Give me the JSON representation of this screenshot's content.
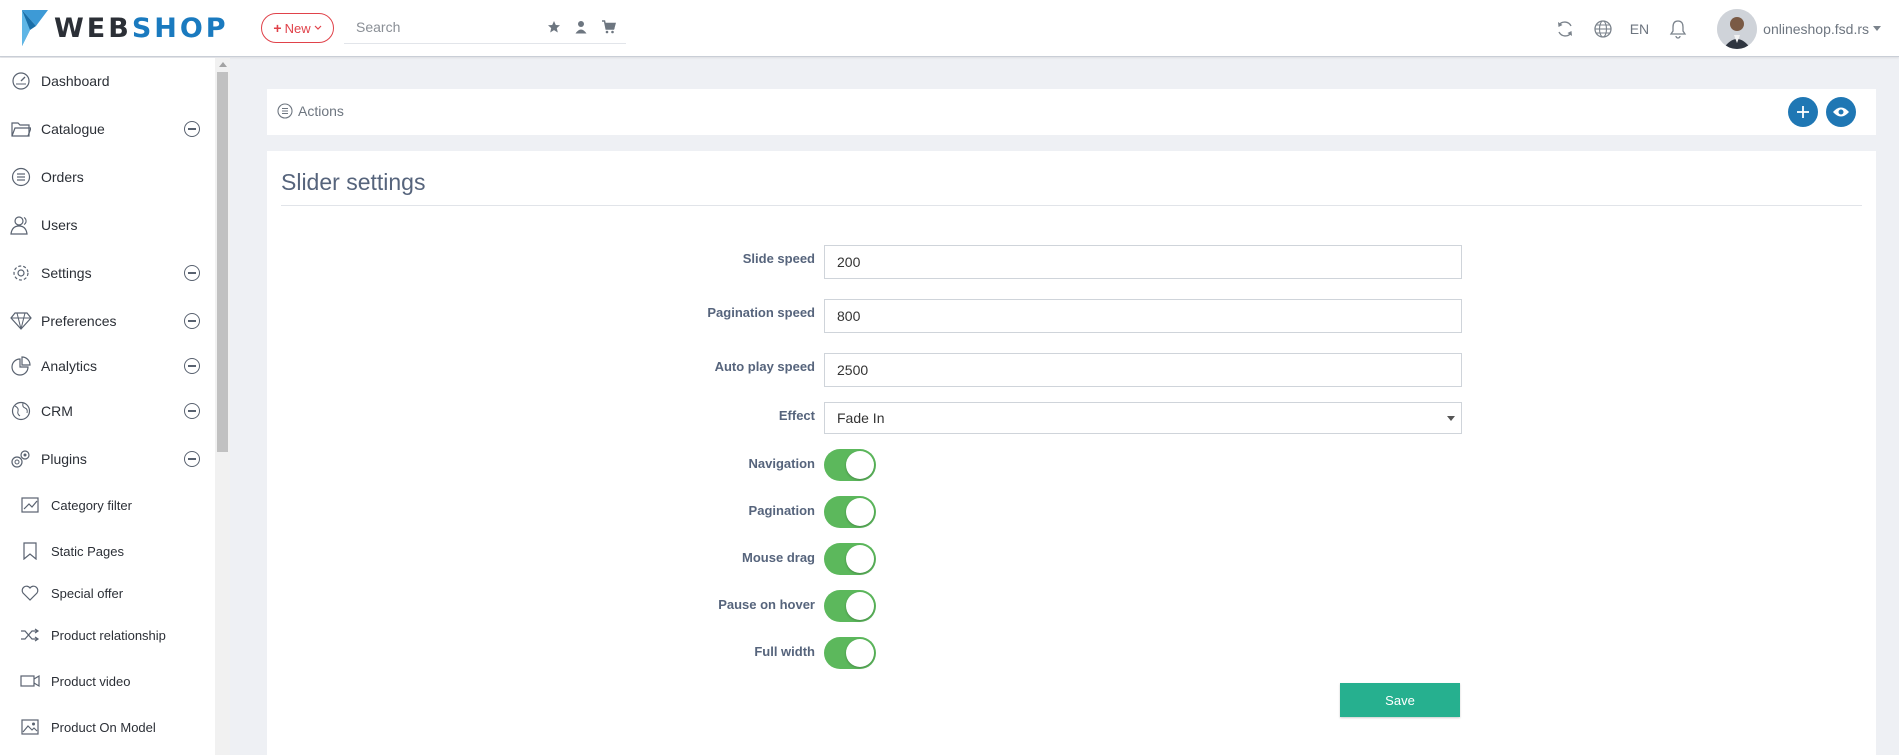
{
  "header": {
    "logo_prefix": "WEB",
    "logo_suffix": "SHOP",
    "new_label": "New",
    "search_placeholder": "Search",
    "lang": "EN",
    "store_name": "onlineshop.fsd.rs"
  },
  "sidebar": {
    "items": [
      {
        "label": "Dashboard",
        "icon": "dashboard-icon"
      },
      {
        "label": "Catalogue",
        "icon": "folder-icon"
      },
      {
        "label": "Orders",
        "icon": "list-icon"
      },
      {
        "label": "Users",
        "icon": "users-icon"
      },
      {
        "label": "Settings",
        "icon": "gear-icon"
      },
      {
        "label": "Preferences",
        "icon": "diamond-icon"
      },
      {
        "label": "Analytics",
        "icon": "pie-chart-icon"
      },
      {
        "label": "CRM",
        "icon": "globe-icon"
      },
      {
        "label": "Plugins",
        "icon": "plugins-icon"
      }
    ],
    "subitems": [
      {
        "label": "Category filter",
        "icon": "chart-icon"
      },
      {
        "label": "Static Pages",
        "icon": "bookmark-icon"
      },
      {
        "label": "Special offer",
        "icon": "heart-icon"
      },
      {
        "label": "Product relationship",
        "icon": "shuffle-icon"
      },
      {
        "label": "Product video",
        "icon": "video-icon"
      },
      {
        "label": "Product On Model",
        "icon": "image-icon"
      }
    ]
  },
  "actions": {
    "label": "Actions"
  },
  "panel": {
    "title": "Slider settings",
    "fields": [
      {
        "label": "Slide speed",
        "value": "200"
      },
      {
        "label": "Pagination speed",
        "value": "800"
      },
      {
        "label": "Auto play speed",
        "value": "2500"
      }
    ],
    "effect": {
      "label": "Effect",
      "value": "Fade In"
    },
    "toggles": [
      {
        "label": "Navigation",
        "on": true
      },
      {
        "label": "Pagination",
        "on": true
      },
      {
        "label": "Mouse drag",
        "on": true
      },
      {
        "label": "Pause on hover",
        "on": true
      },
      {
        "label": "Full width",
        "on": true
      }
    ],
    "save_label": "Save"
  },
  "colors": {
    "brand": "#1a7abf",
    "new_button": "#e0424a",
    "toggle_on": "#5cb85c",
    "save": "#26b08f",
    "round_button": "#1f77b4"
  }
}
